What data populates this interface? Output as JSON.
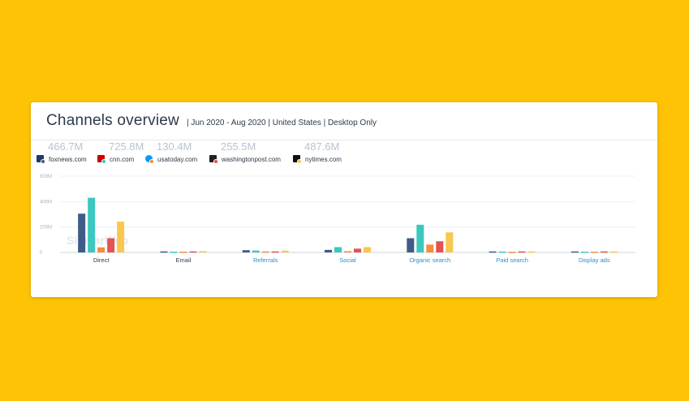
{
  "header": {
    "title": "Channels overview",
    "subtitle": "| Jun 2020 - Aug 2020 | United States | Desktop Only"
  },
  "legend": [
    {
      "total": "466.7M",
      "site": "foxnews.com",
      "color": "#3E5C8A",
      "icon": "foxnews-favicon"
    },
    {
      "total": "725.8M",
      "site": "cnn.com",
      "color": "#3CC8BE",
      "icon": "cnn-favicon"
    },
    {
      "total": "130.4M",
      "site": "usatoday.com",
      "color": "#F58D3D",
      "icon": "usatoday-favicon"
    },
    {
      "total": "255.5M",
      "site": "washingtonpost.com",
      "color": "#E45252",
      "icon": "washingtonpost-favicon"
    },
    {
      "total": "487.6M",
      "site": "nytimes.com",
      "color": "#F9C74F",
      "icon": "nytimes-favicon"
    }
  ],
  "watermark": "SimilarWeb",
  "chart_data": {
    "type": "bar",
    "categories": [
      "Direct",
      "Email",
      "Referrals",
      "Social",
      "Organic search",
      "Paid search",
      "Display ads"
    ],
    "category_colors": [
      "#2c3a4a",
      "#2c3a4a",
      "#2a8fc8",
      "#2a8fc8",
      "#2a8fc8",
      "#2a8fc8",
      "#2a8fc8"
    ],
    "yticks": [
      "0",
      "200M",
      "400M",
      "600M"
    ],
    "ylim": [
      0,
      600
    ],
    "grid": true,
    "series": [
      {
        "name": "foxnews.com",
        "color": "#3E5C8A",
        "values": [
          305,
          8,
          18,
          20,
          112,
          8,
          8
        ]
      },
      {
        "name": "cnn.com",
        "color": "#3CC8BE",
        "values": [
          430,
          6,
          15,
          42,
          218,
          7,
          6
        ]
      },
      {
        "name": "usatoday.com",
        "color": "#F58D3D",
        "values": [
          40,
          6,
          8,
          10,
          62,
          5,
          6
        ]
      },
      {
        "name": "washingtonpost.com",
        "color": "#E45252",
        "values": [
          112,
          8,
          8,
          30,
          88,
          8,
          8
        ]
      },
      {
        "name": "nytimes.com",
        "color": "#F9C74F",
        "values": [
          242,
          10,
          14,
          42,
          158,
          8,
          8
        ]
      }
    ]
  }
}
